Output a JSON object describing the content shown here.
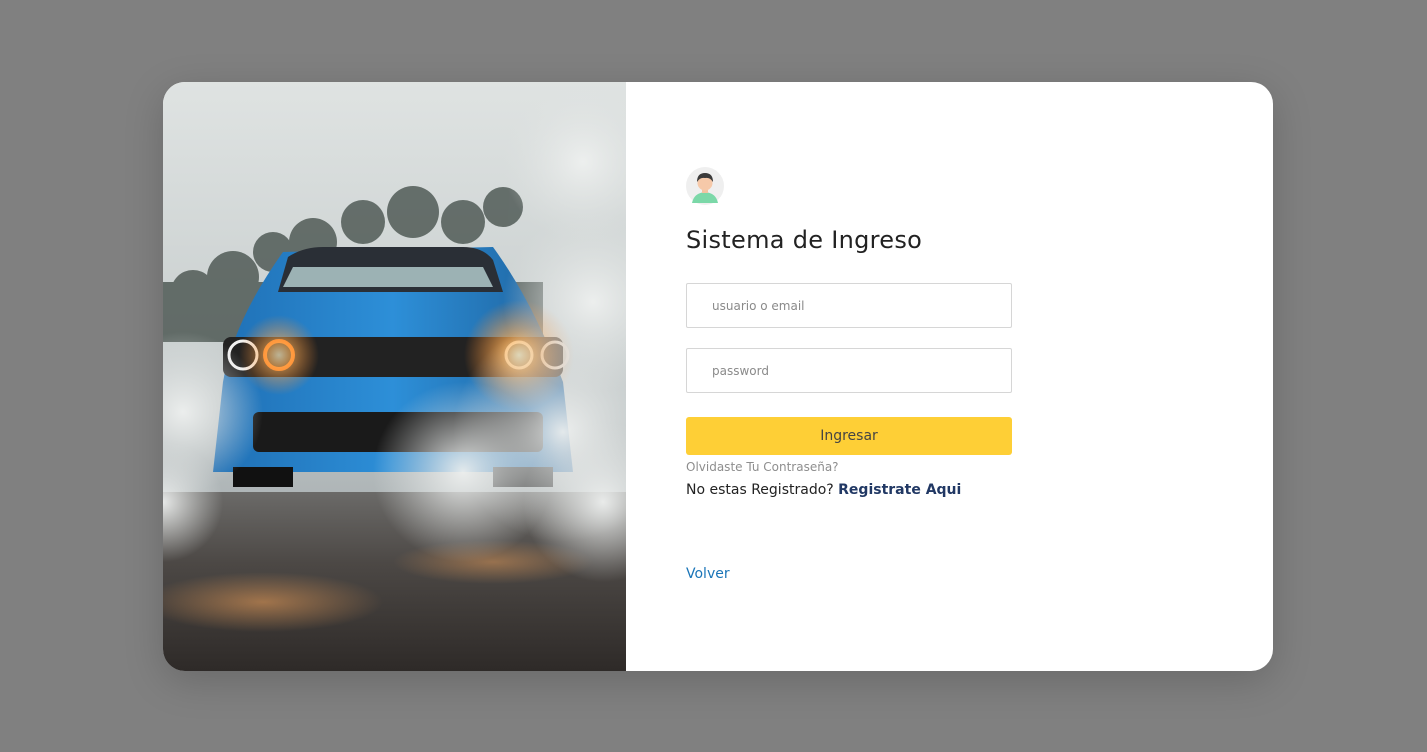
{
  "hero": {
    "image_icon": "car-photo"
  },
  "login": {
    "avatar_icon": "user-avatar-icon",
    "title": "Sistema de Ingreso",
    "username_placeholder": "usuario o email",
    "password_placeholder": "password",
    "submit_label": "Ingresar",
    "forgot_label": "Olvidaste Tu Contraseña?",
    "register_prompt": "No estas Registrado?",
    "register_link": "Registrate Aqui",
    "back_label": "Volver"
  },
  "colors": {
    "page_background": "#808080",
    "card_background": "#ffffff",
    "button_background": "#fecf36",
    "register_link": "#213864",
    "back_link": "#1a75b8",
    "forgot_link": "#8e8e8e"
  }
}
